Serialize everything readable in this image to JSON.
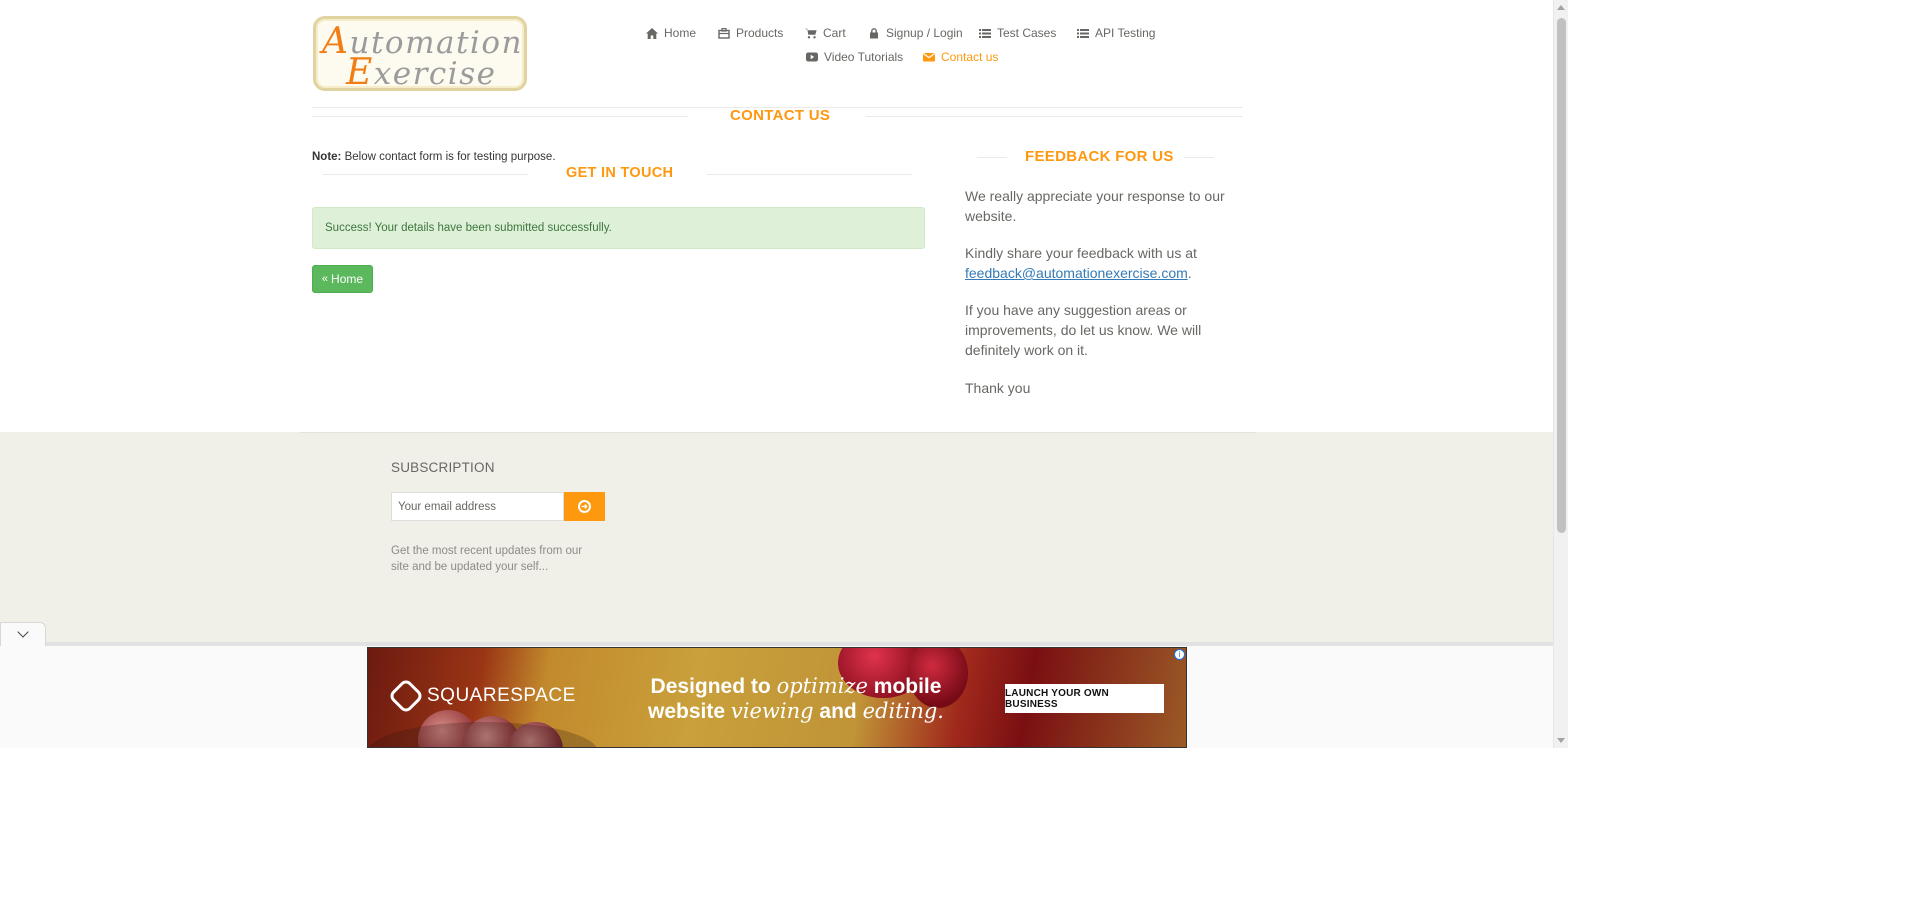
{
  "logo": {
    "line1": "utomation",
    "line1_cap": "A",
    "line2": "xercise",
    "line2_cap": "E"
  },
  "nav": [
    {
      "label": "Home",
      "icon": "home-icon"
    },
    {
      "label": "Products",
      "icon": "products-icon"
    },
    {
      "label": "Cart",
      "icon": "cart-icon"
    },
    {
      "label": "Signup / Login",
      "icon": "lock-icon"
    },
    {
      "label": "Test Cases",
      "icon": "list-icon"
    },
    {
      "label": "API Testing",
      "icon": "list-icon"
    },
    {
      "label": "Video Tutorials",
      "icon": "youtube-icon"
    },
    {
      "label": "Contact us",
      "icon": "envelope-icon",
      "active": true
    }
  ],
  "contact": {
    "title": "CONTACT US",
    "note_label": "Note:",
    "note_text": " Below contact form is for testing purpose.",
    "get_in_touch": "GET IN TOUCH",
    "success_message": "Success! Your details have been submitted successfully.",
    "home_button": "Home"
  },
  "feedback": {
    "title": "FEEDBACK FOR US",
    "p1": "We really appreciate your response to our website.",
    "p2_prefix": "Kindly share your feedback with us at ",
    "p2_email": "feedback@automationexercise.com",
    "p2_suffix": ".",
    "p3": "If you have any suggestion areas or improvements, do let us know. We will definitely work on it.",
    "p4": "Thank you"
  },
  "footer": {
    "subscription_title": "SUBSCRIPTION",
    "email_placeholder": "Your email address",
    "description": "Get the most recent updates from our site and be updated your self..."
  },
  "ad": {
    "brand": "SQUARESPACE",
    "headline_1a": "Designed to ",
    "headline_1b": "optimize",
    "headline_1c": " mobile",
    "headline_2a": "website ",
    "headline_2b": "viewing",
    "headline_2c": " and ",
    "headline_2d": "editing.",
    "cta": "LAUNCH YOUR OWN BUSINESS",
    "info": "i"
  },
  "colors": {
    "accent": "#fe980f",
    "success_bg": "#dff0d8",
    "success_text": "#3c763d",
    "button_green": "#5cb85c",
    "footer_bg": "#f0f0e9",
    "link": "#337ab7"
  }
}
